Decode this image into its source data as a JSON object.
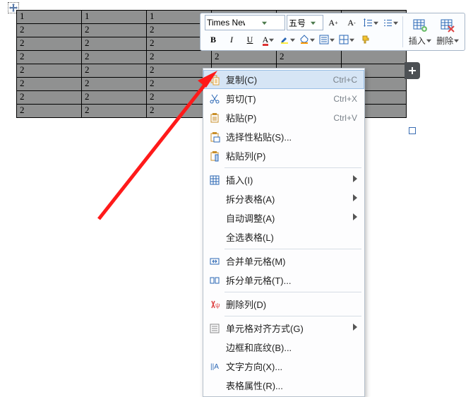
{
  "table": {
    "cols": [
      92,
      92,
      92,
      92,
      92,
      92
    ],
    "rows": [
      [
        "1",
        "1",
        "1",
        "",
        "",
        ""
      ],
      [
        "2",
        "2",
        "2",
        "",
        "",
        ""
      ],
      [
        "2",
        "2",
        "2",
        "",
        "",
        ""
      ],
      [
        "2",
        "2",
        "2",
        "2",
        "2",
        ""
      ],
      [
        "2",
        "2",
        "2",
        "",
        "",
        ""
      ],
      [
        "2",
        "2",
        "2",
        "",
        "",
        ""
      ],
      [
        "2",
        "2",
        "2",
        "",
        "",
        ""
      ],
      [
        "2",
        "2",
        "2",
        "",
        "",
        ""
      ]
    ]
  },
  "toolbar": {
    "font": "Times New Rom",
    "size": "五号",
    "insert": "插入",
    "delete": "删除"
  },
  "context_menu": [
    {
      "icon": "copy",
      "label": "复制(C)",
      "accel": "Ctrl+C",
      "hover": true
    },
    {
      "icon": "cut",
      "label": "剪切(T)",
      "accel": "Ctrl+X"
    },
    {
      "icon": "paste",
      "label": "粘贴(P)",
      "accel": "Ctrl+V"
    },
    {
      "icon": "paste2",
      "label": "选择性粘贴(S)..."
    },
    {
      "icon": "paste3",
      "label": "粘贴列(P)"
    },
    {
      "sep": true
    },
    {
      "icon": "grid",
      "label": "插入(I)",
      "sub": true
    },
    {
      "icon": "",
      "label": "拆分表格(A)",
      "sub": true
    },
    {
      "icon": "",
      "label": "自动调整(A)",
      "sub": true
    },
    {
      "icon": "",
      "label": "全选表格(L)"
    },
    {
      "sep": true
    },
    {
      "icon": "merge",
      "label": "合并单元格(M)"
    },
    {
      "icon": "split",
      "label": "拆分单元格(T)..."
    },
    {
      "sep": true
    },
    {
      "icon": "delcol",
      "label": "删除列(D)"
    },
    {
      "sep": true
    },
    {
      "icon": "align",
      "label": "单元格对齐方式(G)",
      "sub": true
    },
    {
      "icon": "",
      "label": "边框和底纹(B)..."
    },
    {
      "icon": "textdir",
      "label": "文字方向(X)..."
    },
    {
      "icon": "",
      "label": "表格属性(R)..."
    }
  ]
}
